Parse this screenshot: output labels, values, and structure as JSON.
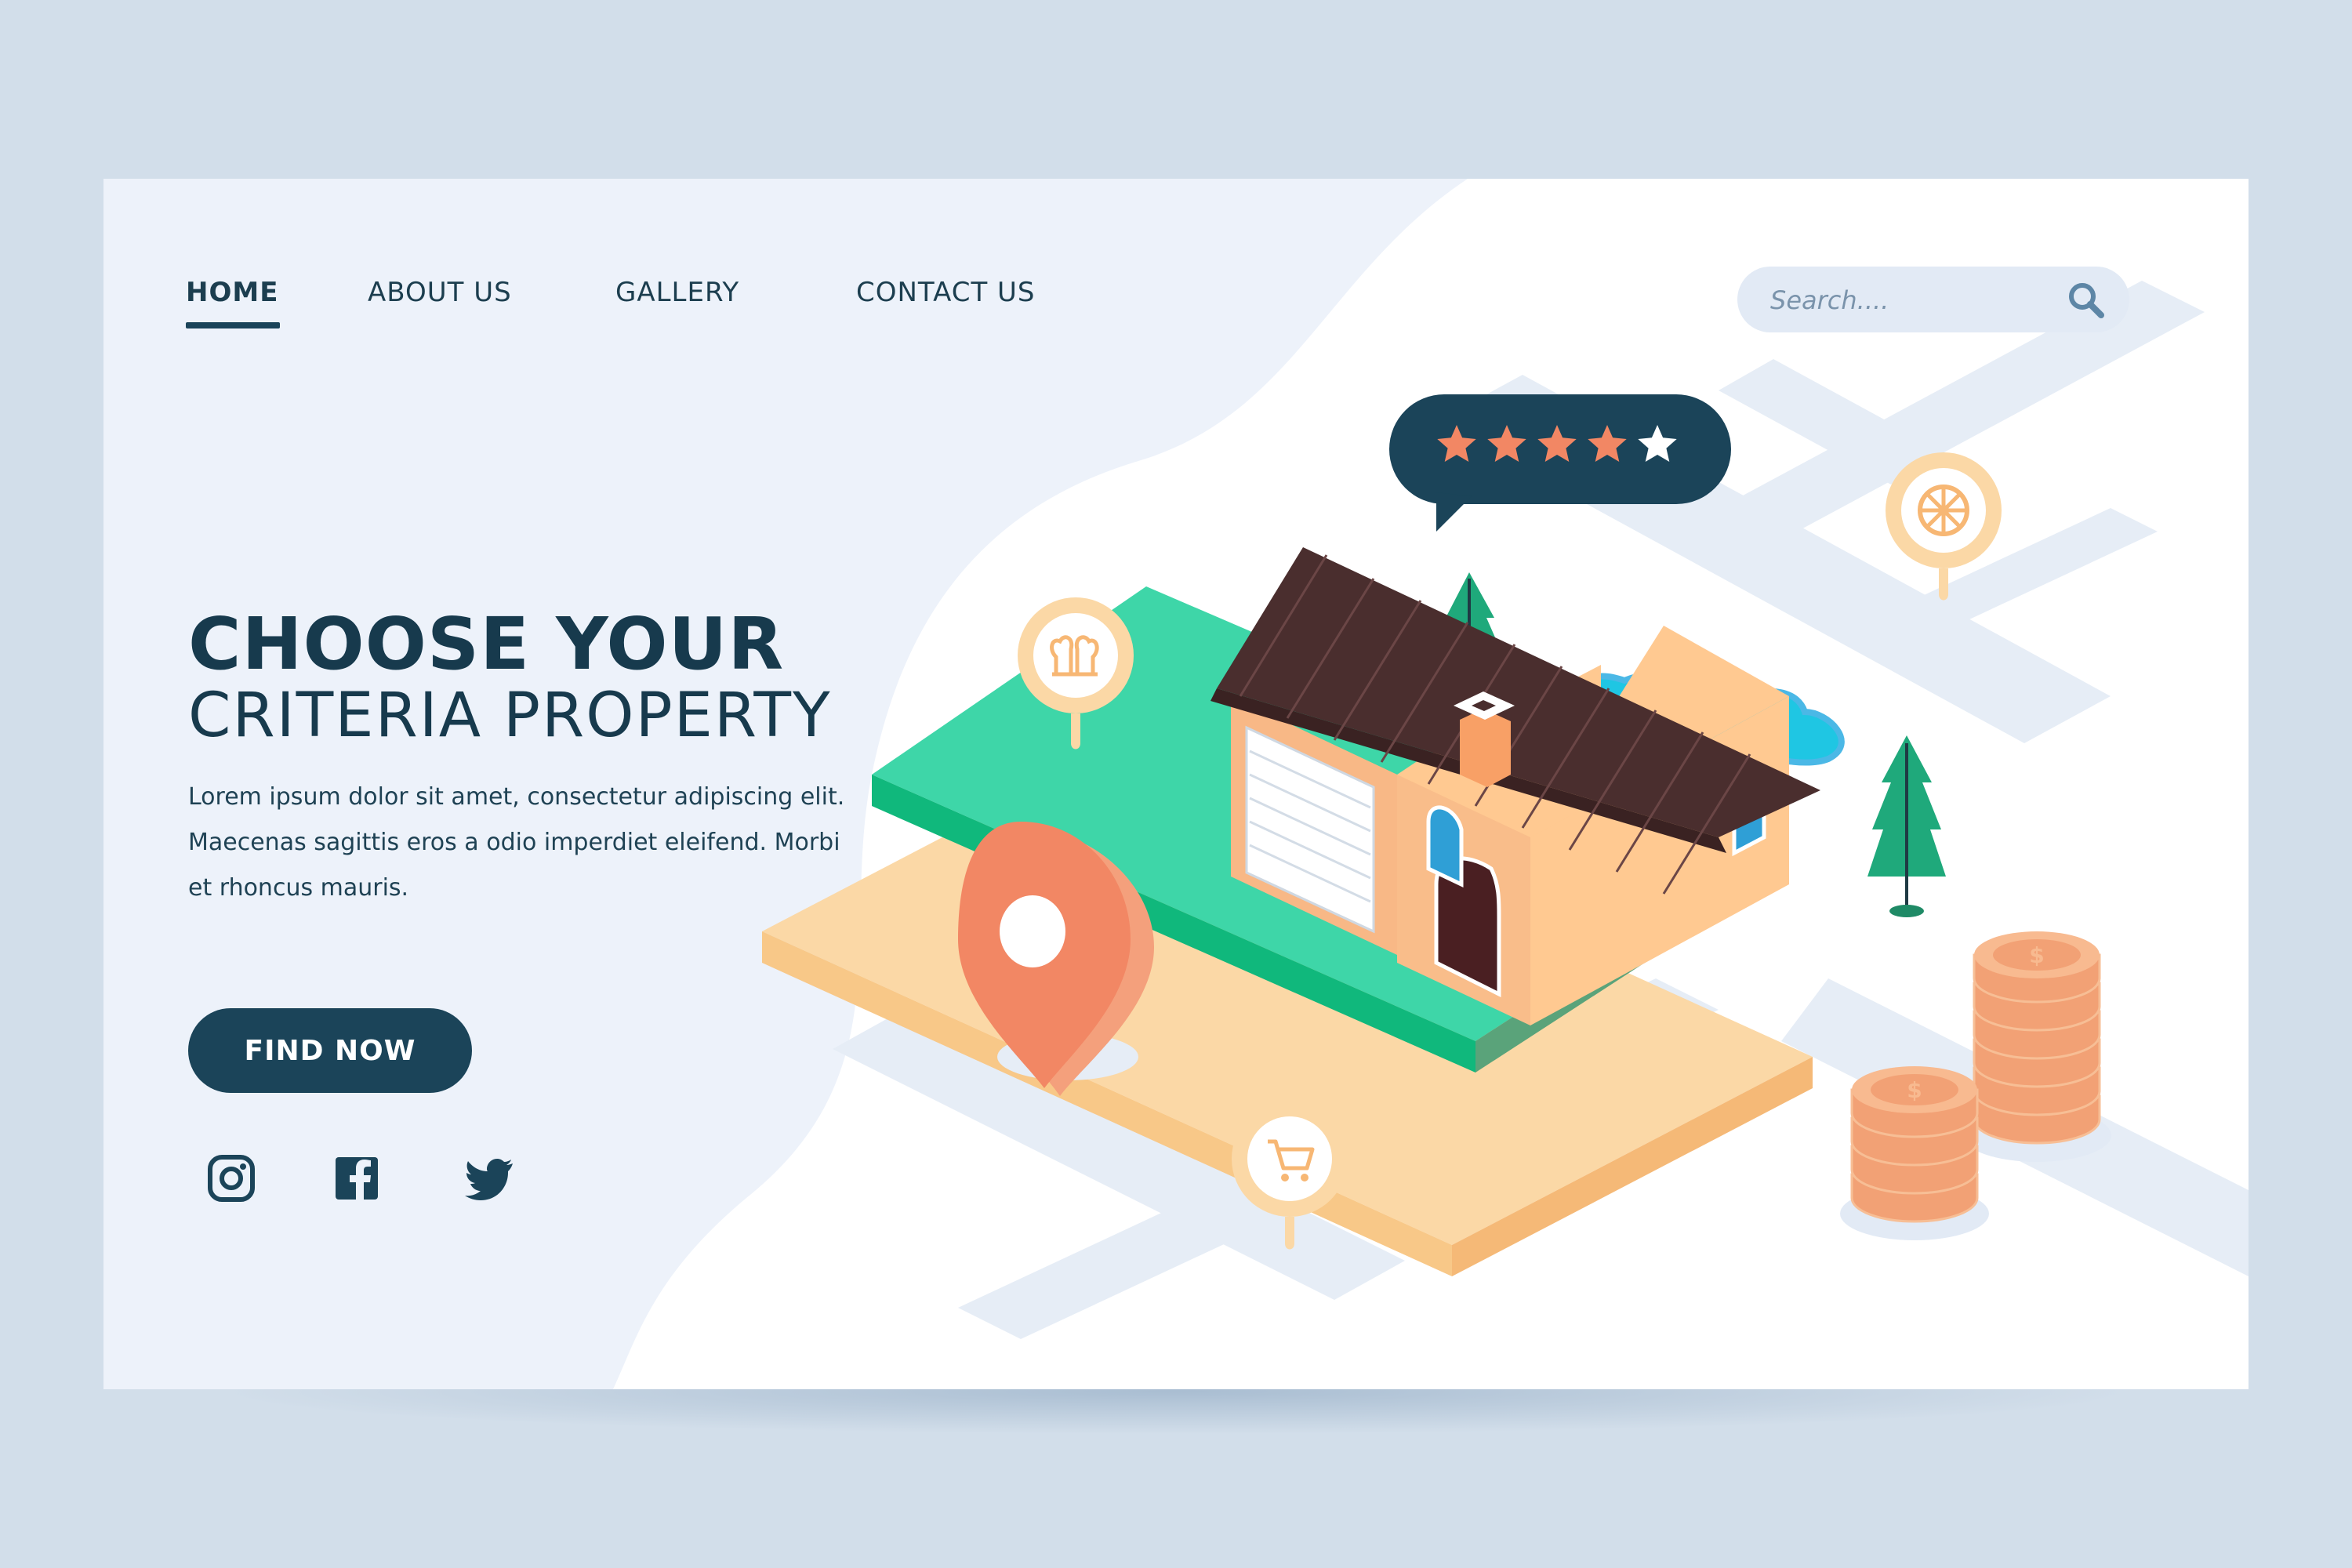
{
  "nav": {
    "items": [
      {
        "label": "HOME",
        "active": true
      },
      {
        "label": "ABOUT US",
        "active": false
      },
      {
        "label": "GALLERY",
        "active": false
      },
      {
        "label": "CONTACT US",
        "active": false
      }
    ]
  },
  "search": {
    "placeholder": "Search...."
  },
  "hero": {
    "title": "CHOOSE YOUR",
    "subtitle": "CRITERIA PROPERTY",
    "description": "Lorem ipsum dolor sit amet, consectetur adipiscing elit. Maecenas sagittis eros a odio imperdiet eleifend. Morbi et rhoncus mauris.",
    "button_label": "FIND NOW"
  },
  "social": {
    "icons": [
      "instagram-icon",
      "facebook-icon",
      "twitter-icon"
    ]
  },
  "rating": {
    "value": 4,
    "max": 5
  },
  "colors": {
    "primary": "#1b4459",
    "background": "#edf2fa",
    "accent_orange": "#f28764",
    "grass": "#3ed6a8",
    "pin_beige": "#fbd8a6"
  }
}
